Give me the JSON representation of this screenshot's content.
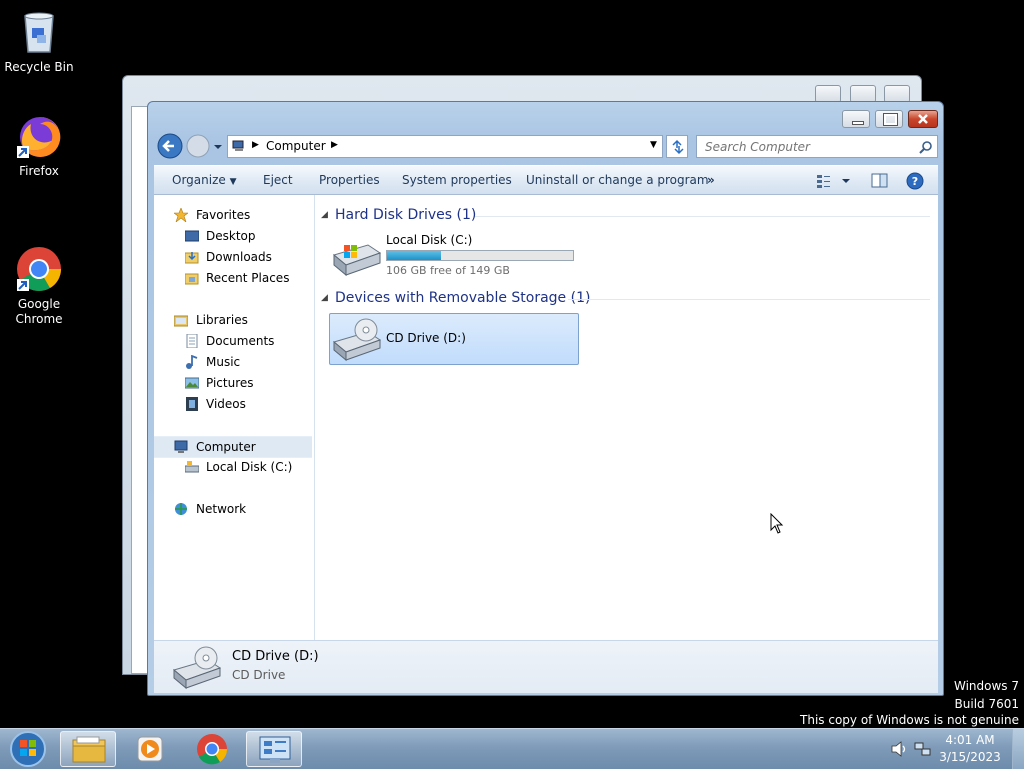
{
  "desktop": {
    "icons": [
      {
        "label": "Recycle Bin",
        "icon": "recycle-bin-icon"
      },
      {
        "label": "Firefox",
        "icon": "firefox-icon"
      },
      {
        "label": "Google\nChrome",
        "icon": "chrome-icon"
      }
    ],
    "watermark": {
      "line1": "Windows 7",
      "line2": "Build 7601",
      "line3": "This copy of Windows is not genuine"
    }
  },
  "explorer": {
    "address": {
      "crumb": "Computer"
    },
    "search": {
      "placeholder": "Search Computer"
    },
    "commands": {
      "organize": "Organize",
      "eject": "Eject",
      "properties": "Properties",
      "system_properties": "System properties",
      "uninstall": "Uninstall or change a program",
      "more": "»"
    },
    "nav": {
      "favorites": "Favorites",
      "desktop": "Desktop",
      "downloads": "Downloads",
      "recent": "Recent Places",
      "libraries": "Libraries",
      "documents": "Documents",
      "music": "Music",
      "pictures": "Pictures",
      "videos": "Videos",
      "computer": "Computer",
      "local_disk": "Local Disk (C:)",
      "network": "Network"
    },
    "groups": {
      "hard_disk": "Hard Disk Drives (1)",
      "removable": "Devices with Removable Storage (1)"
    },
    "drives": {
      "c_name": "Local Disk (C:)",
      "c_free": "106 GB free of 149 GB",
      "c_used_fraction": 0.29,
      "d_name": "CD Drive (D:)"
    },
    "details": {
      "name": "CD Drive (D:)",
      "type": "CD Drive"
    }
  },
  "taskbar": {
    "time": "4:01 AM",
    "date": "3/15/2023",
    "apps": [
      "start-orb-icon",
      "explorer-icon",
      "media-player-icon",
      "chrome-icon",
      "control-panel-icon"
    ]
  },
  "colors": {
    "accent": "#3c7fb1",
    "selection": "#cce4f7",
    "progress": "#26a0da"
  }
}
